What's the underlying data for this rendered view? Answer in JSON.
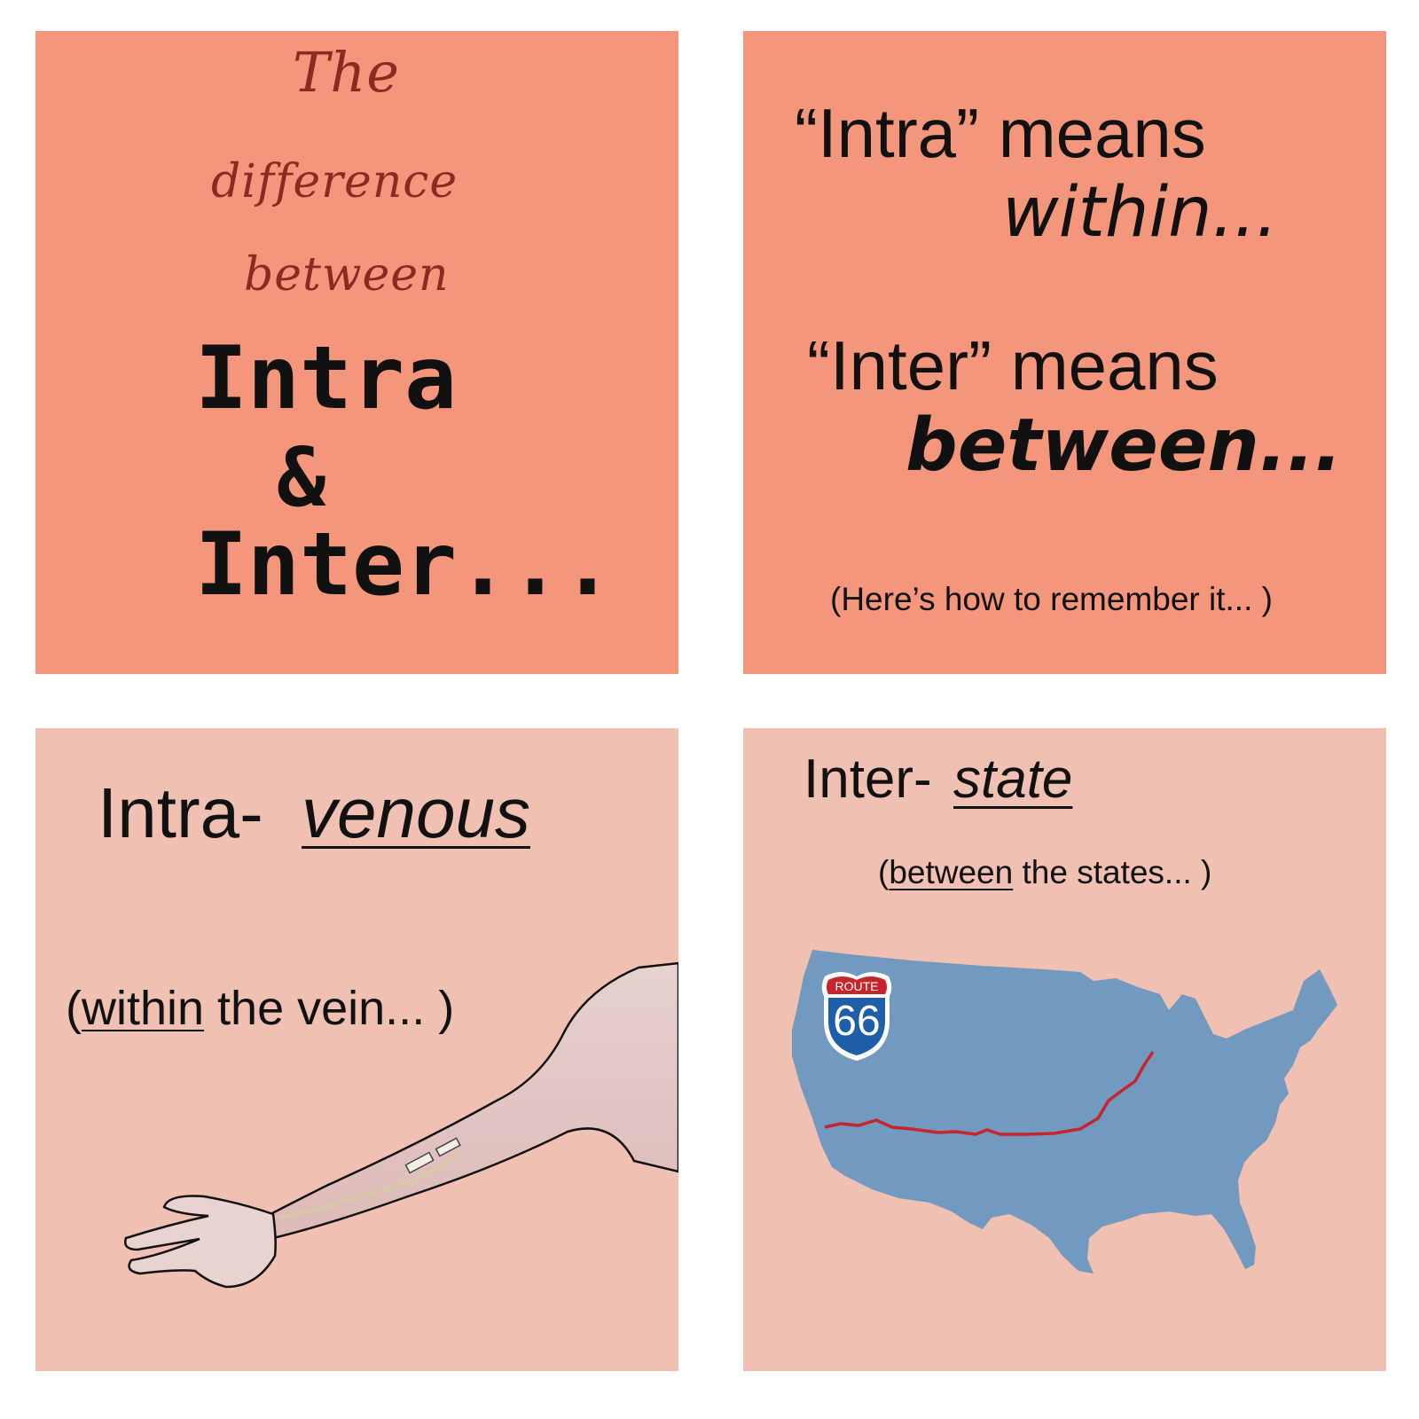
{
  "panel1": {
    "the": "The",
    "difference": "difference",
    "between": "between",
    "intra": "Intra",
    "amp": "&",
    "inter": "Inter..."
  },
  "panel2": {
    "intra_line": "“Intra” means",
    "within": "within...",
    "inter_line": "“Inter” means",
    "between": "between...",
    "remember": "(Here’s how to remember it... )"
  },
  "panel3": {
    "prefix": "Intra-",
    "word": "venous",
    "paren_open": "(",
    "within": "within",
    "rest": " the vein... )"
  },
  "panel4": {
    "prefix": "Inter-",
    "word": "state",
    "paren_open": "(",
    "between": "between",
    "rest": " the states... )",
    "sign_route": "ROUTE",
    "sign_number": "66"
  },
  "colors": {
    "panel_top": "#f3967b",
    "panel_bottom": "#f0c0b2",
    "script_text": "#8b2a22",
    "map_blue": "#7299bf",
    "route_red": "#c8242c"
  }
}
